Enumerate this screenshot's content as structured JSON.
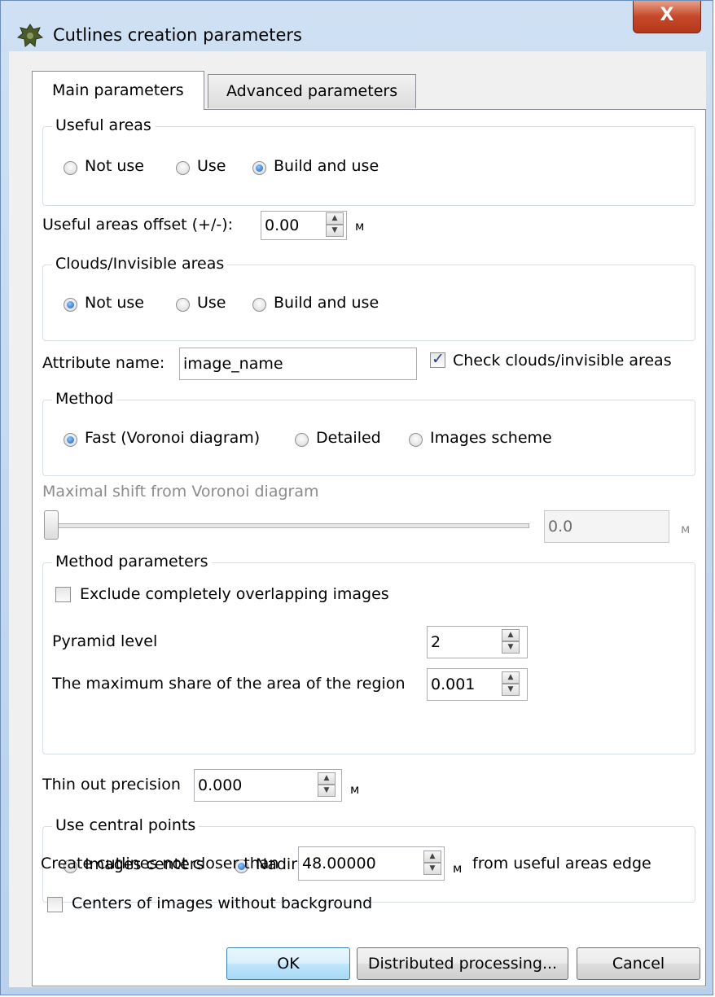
{
  "window": {
    "title": "Cutlines creation parameters",
    "close_label": "X"
  },
  "tabs": [
    {
      "label": "Main parameters",
      "active": true
    },
    {
      "label": "Advanced parameters",
      "active": false
    }
  ],
  "useful_areas": {
    "title": "Useful areas",
    "options": [
      "Not use",
      "Use",
      "Build and use"
    ],
    "selected": "Build and use"
  },
  "useful_areas_offset": {
    "label": "Useful areas offset (+/-):",
    "value": "0.00",
    "unit": "м"
  },
  "clouds": {
    "title": "Clouds/Invisible areas",
    "options": [
      "Not use",
      "Use",
      "Build and use"
    ],
    "selected": "Not use"
  },
  "attribute": {
    "label": "Attribute name:",
    "value": "image_name",
    "check_label": "Check clouds/invisible areas",
    "checked": true
  },
  "method": {
    "title": "Method",
    "options": [
      "Fast (Voronoi diagram)",
      "Detailed",
      "Images scheme"
    ],
    "selected": "Fast (Voronoi diagram)"
  },
  "max_shift": {
    "label": "Maximal shift from Voronoi diagram",
    "value": "0.0",
    "unit": "м",
    "slider_level": 0
  },
  "method_params": {
    "title": "Method parameters",
    "exclude_label": "Exclude completely overlapping images",
    "exclude_checked": false,
    "pyramid_label": "Pyramid level",
    "pyramid_value": "2",
    "share_label": "The maximum share of the area of the region",
    "share_value": "0.001"
  },
  "thin_out": {
    "label": "Thin out precision",
    "value": "0.000",
    "unit": "м"
  },
  "central_points": {
    "title": "Use central points",
    "options": [
      "Images centers",
      "Nadir points"
    ],
    "selected": "Nadir points"
  },
  "cutlines_distance": {
    "label": "Create cutlines not closer than",
    "value": "48.00000",
    "unit": "м",
    "suffix": "from useful areas edge"
  },
  "centers_without_bg": {
    "label": "Centers of images without background",
    "checked": false
  },
  "buttons": {
    "ok": "OK",
    "distributed": "Distributed processing...",
    "cancel": "Cancel"
  }
}
